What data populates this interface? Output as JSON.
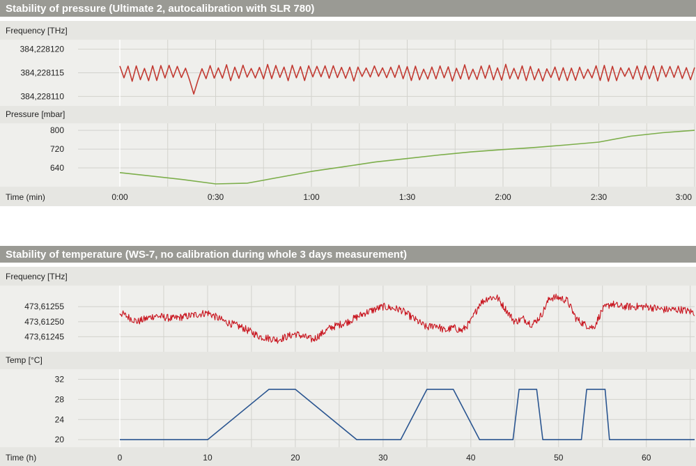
{
  "colors": {
    "title_bar": "#9a9a94",
    "label_band": "#e6e6e2",
    "plot_bg": "#efefec",
    "grid": "#d2d2cd",
    "frequency_line": "#c23a32",
    "frequency_line_dense": "#c8141e",
    "pressure_line": "#7cae4a",
    "temp_line": "#2a5590"
  },
  "chart_data": [
    {
      "type": "line",
      "title": "Stability of pressure (Ultimate 2, autocalibration with  SLR 780)",
      "xlabel": "Time (min)",
      "x_ticks": [
        "0:00",
        "0:30",
        "1:00",
        "1:30",
        "2:00",
        "2:30",
        "3:00"
      ],
      "x_tick_values": [
        0,
        30,
        60,
        90,
        120,
        150,
        180
      ],
      "xlim": [
        0,
        180
      ],
      "grid": true,
      "panels": [
        {
          "ylabel": "Frequency [THz]",
          "y_ticks": [
            "384,228120",
            "384,228115",
            "384,228110"
          ],
          "y_tick_values": [
            384.22812,
            384.228115,
            384.22811
          ],
          "ylim": [
            384.228108,
            384.228122
          ],
          "series": [
            {
              "style": "sawtooth",
              "baseline": 384.228115,
              "amplitude": 1.5e-06,
              "x": [
                0,
                180
              ],
              "y": [
                384.228115,
                384.228115
              ]
            }
          ]
        },
        {
          "ylabel": "Pressure [mbar]",
          "y_ticks": [
            "800",
            "720",
            "640"
          ],
          "y_tick_values": [
            800,
            720,
            640
          ],
          "ylim": [
            560,
            830
          ],
          "series": [
            {
              "x": [
                0,
                10,
                20,
                30,
                40,
                50,
                60,
                70,
                80,
                90,
                100,
                110,
                120,
                130,
                140,
                150,
                160,
                170,
                180
              ],
              "y": [
                620,
                605,
                590,
                572,
                575,
                600,
                625,
                645,
                665,
                680,
                695,
                708,
                718,
                727,
                738,
                750,
                775,
                790,
                800
              ]
            }
          ]
        }
      ]
    },
    {
      "type": "line",
      "title": "Stability of temperature (WS-7, no calibration during whole 3 days measurement)",
      "xlabel": "Time (h)",
      "x_ticks": [
        "0",
        "10",
        "20",
        "30",
        "40",
        "50",
        "60"
      ],
      "x_tick_values": [
        0,
        10,
        20,
        30,
        40,
        50,
        60
      ],
      "xlim": [
        0,
        65.5
      ],
      "grid": true,
      "panels": [
        {
          "ylabel": "Frequency [THz]",
          "y_ticks": [
            "473,61255",
            "473,61250",
            "473,61245"
          ],
          "y_tick_values": [
            473.61255,
            473.6125,
            473.61245
          ],
          "ylim": [
            473.6124,
            473.61262
          ],
          "series": [
            {
              "style": "noisy",
              "x": [
                0,
                2,
                4,
                6,
                8,
                10,
                12,
                14,
                16,
                18,
                20,
                22,
                24,
                26,
                28,
                30,
                32,
                34,
                35,
                36,
                37,
                38,
                39,
                40,
                41,
                42,
                43,
                44,
                45,
                46,
                47,
                48,
                49,
                50,
                51,
                52,
                53,
                54,
                55,
                56,
                57,
                58,
                60,
                62,
                64,
                65.5
              ],
              "y": [
                473.61253,
                473.6125,
                473.61252,
                473.61251,
                473.61252,
                473.61253,
                473.6125,
                473.61248,
                473.61245,
                473.61244,
                473.61246,
                473.61244,
                473.61248,
                473.6125,
                473.61253,
                473.61255,
                473.61254,
                473.6125,
                473.61248,
                473.61249,
                473.61247,
                473.61248,
                473.61247,
                473.6125,
                473.61256,
                473.61258,
                473.61258,
                473.61254,
                473.6125,
                473.61251,
                473.61249,
                473.61252,
                473.61258,
                473.61258,
                473.61257,
                473.61251,
                473.61249,
                473.61248,
                473.61254,
                473.61256,
                473.61255,
                473.61255,
                473.61255,
                473.61254,
                473.61254,
                473.61253
              ]
            }
          ]
        },
        {
          "ylabel": "Temp [°C]",
          "y_ticks": [
            "32",
            "28",
            "24",
            "20"
          ],
          "y_tick_values": [
            32,
            28,
            24,
            20
          ],
          "ylim": [
            18.5,
            34
          ],
          "series": [
            {
              "x": [
                0,
                10,
                17,
                20,
                27,
                32,
                35,
                38,
                41,
                44,
                44.8,
                45.5,
                47.5,
                48.2,
                49,
                52,
                52.6,
                53.2,
                55.3,
                55.8,
                58,
                65.5
              ],
              "y": [
                20,
                20,
                30,
                30,
                20,
                20,
                30,
                30,
                20,
                20,
                20,
                30,
                30,
                20,
                20,
                20,
                20,
                30,
                30,
                20,
                20,
                20
              ]
            }
          ]
        }
      ]
    }
  ]
}
